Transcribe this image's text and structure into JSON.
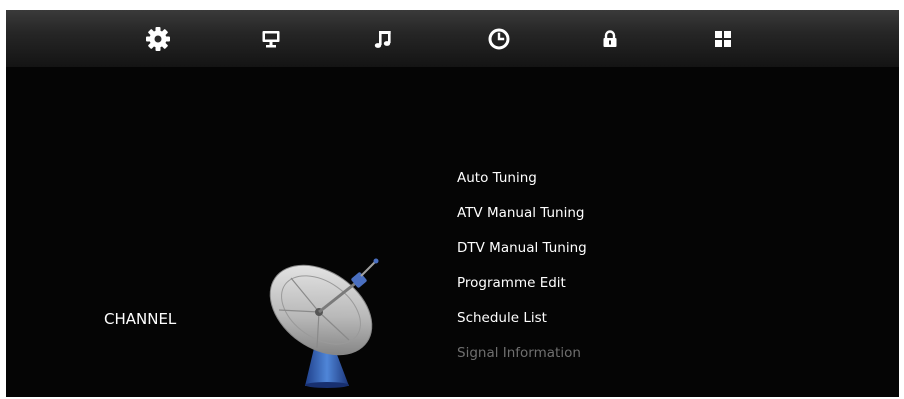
{
  "tabs": [
    {
      "icon": "gear-icon"
    },
    {
      "icon": "monitor-icon"
    },
    {
      "icon": "music-note-icon"
    },
    {
      "icon": "clock-icon"
    },
    {
      "icon": "lock-icon"
    },
    {
      "icon": "app-grid-icon"
    }
  ],
  "category": {
    "label": "CHANNEL",
    "icon": "satellite-dish-icon"
  },
  "menu": {
    "items": [
      {
        "label": "Auto Tuning",
        "enabled": true
      },
      {
        "label": "ATV Manual Tuning",
        "enabled": true
      },
      {
        "label": "DTV Manual Tuning",
        "enabled": true
      },
      {
        "label": "Programme Edit",
        "enabled": true
      },
      {
        "label": "Schedule List",
        "enabled": true
      },
      {
        "label": "Signal Information",
        "enabled": false
      }
    ]
  },
  "colors": {
    "background": "#050505",
    "text": "#ffffff",
    "disabled_text": "#6f6f6f"
  }
}
